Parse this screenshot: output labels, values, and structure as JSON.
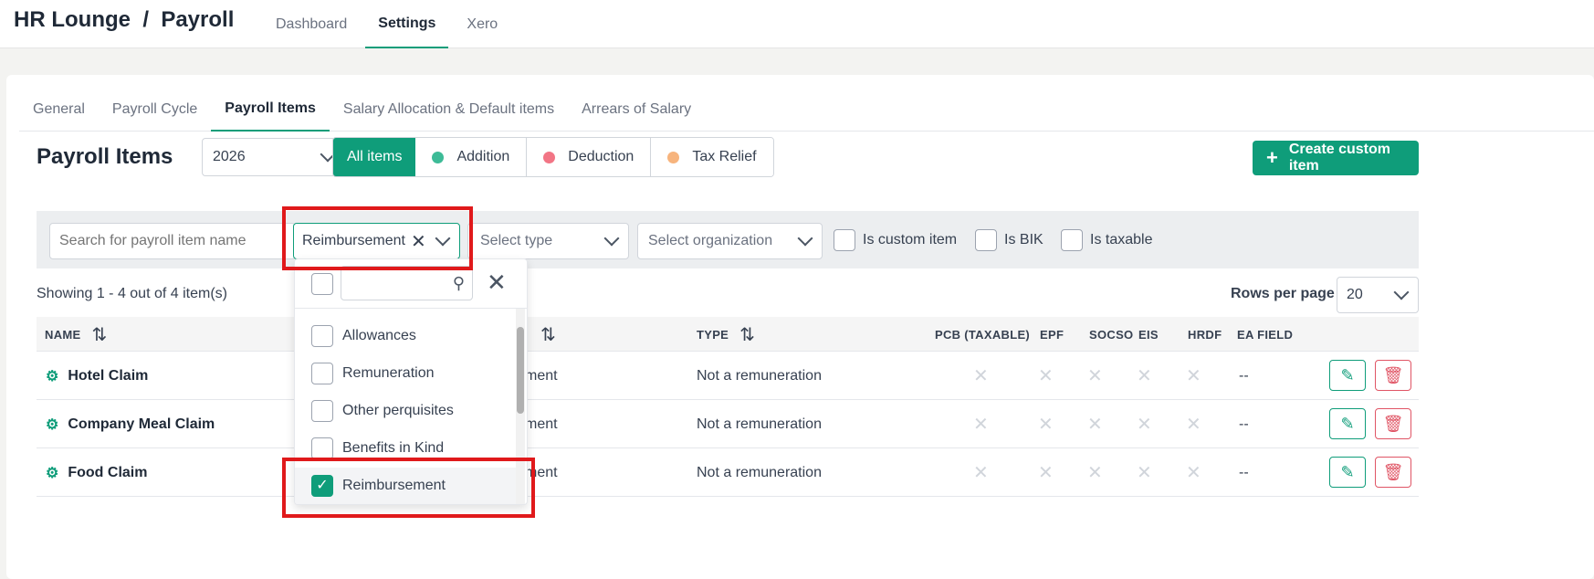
{
  "app": {
    "title": "HR Lounge  /  Payroll"
  },
  "top_nav": [
    "Dashboard",
    "Settings",
    "Xero"
  ],
  "sub_tabs": [
    "General",
    "Payroll Cycle",
    "Payroll Items",
    "Salary Allocation & Default items",
    "Arrears of Salary"
  ],
  "section_title": "Payroll Items",
  "year": "2026",
  "filters": {
    "all": "All items",
    "addition": "Addition",
    "deduction": "Deduction",
    "tax_relief": "Tax Relief"
  },
  "colors": {
    "accent": "#0f9d7a",
    "addition": "#3dbb97",
    "deduction": "#f27585",
    "tax_relief": "#f7b47d",
    "danger": "#e05565",
    "highlight": "#e0191b"
  },
  "create_button": "Create custom item",
  "filter_bar": {
    "search_placeholder": "Search for payroll item name",
    "category_value": "Reimbursement",
    "type_placeholder": "Select type",
    "org_placeholder": "Select organization",
    "is_custom": "Is custom item",
    "is_bik": "Is BIK",
    "is_taxable": "Is taxable"
  },
  "showing": "Showing 1 - 4 out of 4 item(s)",
  "rows_per_page": {
    "label": "Rows per page",
    "value": "20"
  },
  "columns": {
    "name": "NAME",
    "type": "TYPE",
    "pcb": "PCB (TAXABLE)",
    "epf": "EPF",
    "socso": "SOCSO",
    "eis": "EIS",
    "hrdf": "HRDF",
    "ea": "EA FIELD"
  },
  "rows": [
    {
      "name": "Hotel Claim",
      "category": "ment",
      "type": "Not a remuneration",
      "ea": "--"
    },
    {
      "name": "Company Meal Claim",
      "category": "ment",
      "type": "Not a remuneration",
      "ea": "--"
    },
    {
      "name": "Food Claim",
      "category": "ment",
      "type": "Not a remuneration",
      "ea": "--"
    }
  ],
  "dropdown": {
    "options": [
      "Allowances",
      "Remuneration",
      "Other perquisites",
      "Benefits in Kind",
      "Reimbursement"
    ],
    "selected": "Reimbursement"
  }
}
